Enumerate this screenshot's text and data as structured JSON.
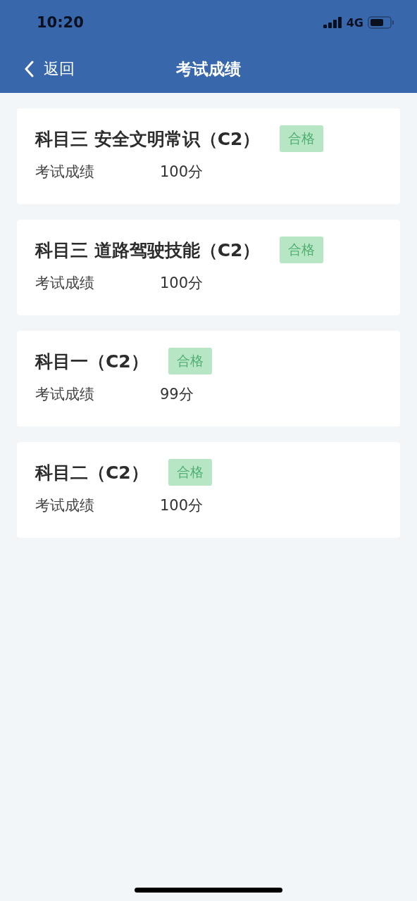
{
  "status_bar": {
    "time": "10:20",
    "network": "4G"
  },
  "nav_bar": {
    "back_label": "返回",
    "title": "考试成绩"
  },
  "results": [
    {
      "subject": "科目三 安全文明常识（C2）",
      "badge": "合格",
      "score_label": "考试成绩",
      "score": "100分"
    },
    {
      "subject": "科目三 道路驾驶技能（C2）",
      "badge": "合格",
      "score_label": "考试成绩",
      "score": "100分"
    },
    {
      "subject": "科目一（C2）",
      "badge": "合格",
      "score_label": "考试成绩",
      "score": "99分"
    },
    {
      "subject": "科目二（C2）",
      "badge": "合格",
      "score_label": "考试成绩",
      "score": "100分"
    }
  ]
}
